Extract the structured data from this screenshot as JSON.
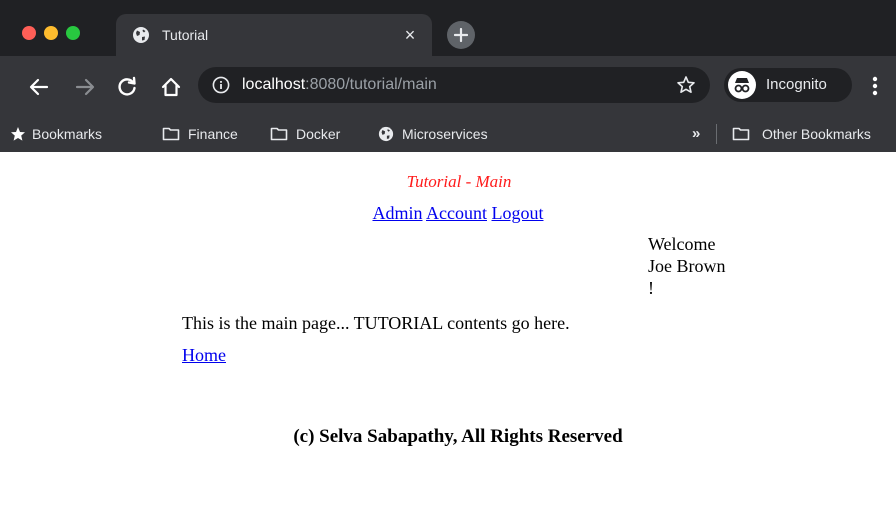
{
  "browser": {
    "tab": {
      "title": "Tutorial",
      "close_glyph": "×"
    },
    "new_tab_glyph": "+",
    "url": {
      "host": "localhost",
      "rest": ":8080/tutorial/main"
    },
    "profile": {
      "label": "Incognito"
    },
    "bookmarks": [
      {
        "label": "Bookmarks",
        "icon": "star-icon"
      },
      {
        "label": "Finance",
        "icon": "folder-icon"
      },
      {
        "label": "Docker",
        "icon": "folder-icon"
      },
      {
        "label": "Microservices",
        "icon": "globe-icon"
      }
    ],
    "overflow_glyph": "»",
    "other_bookmarks": "Other Bookmarks",
    "colors": {
      "frame": "#202124",
      "toolbar": "#35363a",
      "text": "#e8eaed"
    }
  },
  "page": {
    "title": "Tutorial - Main",
    "nav": {
      "admin": "Admin",
      "account": "Account",
      "logout": "Logout"
    },
    "welcome": {
      "line1": "Welcome",
      "line2": "Joe Brown",
      "line3": "!"
    },
    "main_text": "This is the main page... TUTORIAL contents go here.",
    "home_link": "Home",
    "footer": "(c) Selva Sabapathy, All Rights Reserved",
    "colors": {
      "title": "#ff1a1a",
      "link": "#0000ee"
    }
  }
}
